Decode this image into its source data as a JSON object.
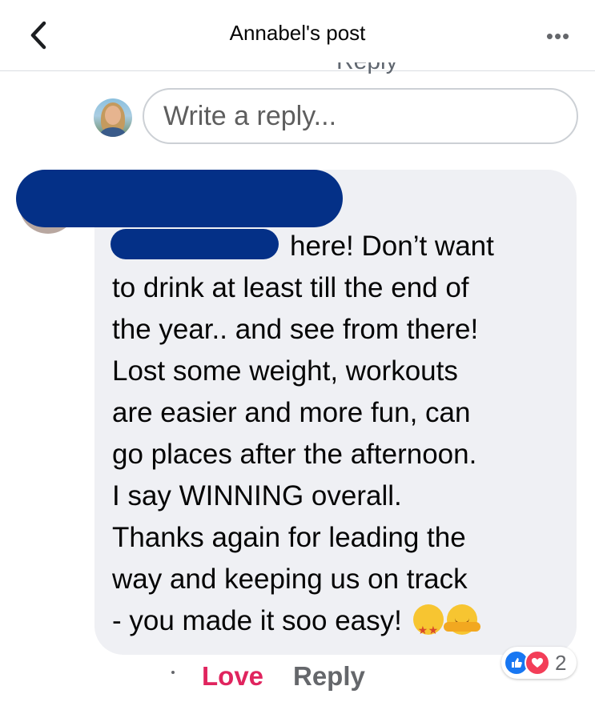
{
  "header": {
    "title": "Annabel's post",
    "back_icon": "chevron-left-icon",
    "more_icon": "more-horizontal-icon",
    "more_glyph": "•••"
  },
  "clipped_comment_fragment": "Reply",
  "reply_box": {
    "placeholder": "Write a reply..."
  },
  "comment": {
    "author": "",
    "text_lines": [
      "here! Don’t want",
      "to drink at least till the end of",
      "the year.. and see from there!",
      "Lost some weight, workouts",
      "are easier and more fun, can",
      "go places after the afternoon.",
      "I say WINNING overall.",
      "Thanks again for leading the",
      "way and keeping us on track",
      "- you made it soo easy!"
    ],
    "emojis": [
      "star-struck-emoji",
      "hugging-face-emoji"
    ],
    "reactions": {
      "icons": [
        "like-icon",
        "love-icon"
      ],
      "count": "2"
    }
  },
  "actions": {
    "love_label": "Love",
    "reply_label": "Reply"
  },
  "colors": {
    "love": "#e0245e",
    "bubble": "#eff0f4",
    "redaction": "#043087",
    "like": "#1877f2",
    "heart": "#f33e58"
  }
}
